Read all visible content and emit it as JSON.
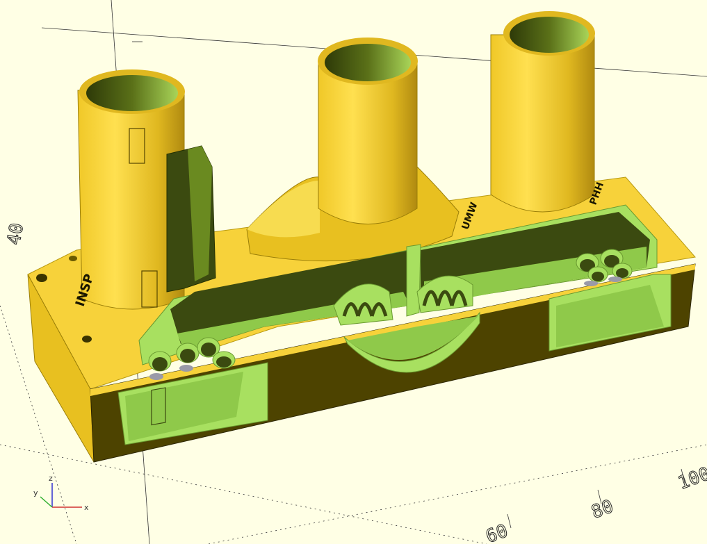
{
  "colors": {
    "background": "#ffffe5",
    "face_front": "#f7d23a",
    "face_dark": "#4d4300",
    "face_mid": "#7a6a00",
    "cut_light": "#a8e060",
    "cut_mid": "#8fc94a",
    "cut_dark": "#3b4a10",
    "axis_x": "#d03030",
    "axis_y": "#30b030",
    "axis_z": "#3030d0"
  },
  "axis_ticks": [
    "40",
    "60",
    "80",
    "100"
  ],
  "model_labels": [
    "INSP",
    "UMW",
    "PHH"
  ],
  "gizmo": {
    "x": "x",
    "y": "y",
    "z": "z"
  },
  "title_icons": [
    "orientation-gizmo-icon"
  ]
}
